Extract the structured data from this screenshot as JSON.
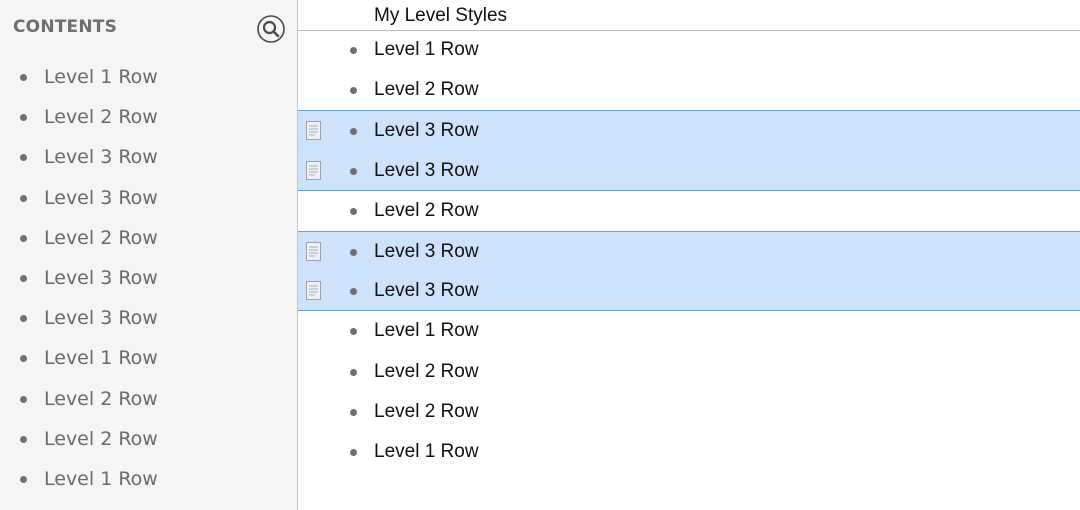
{
  "sidebar": {
    "title": "CONTENTS",
    "search_icon": "magnifier-icon",
    "items": [
      {
        "label": "Level 1 Row"
      },
      {
        "label": "Level 2 Row"
      },
      {
        "label": "Level 3 Row"
      },
      {
        "label": "Level 3 Row"
      },
      {
        "label": "Level 2 Row"
      },
      {
        "label": "Level 3 Row"
      },
      {
        "label": "Level 3 Row"
      },
      {
        "label": "Level 1 Row"
      },
      {
        "label": "Level 2 Row"
      },
      {
        "label": "Level 2 Row"
      },
      {
        "label": "Level 1 Row"
      }
    ]
  },
  "editor": {
    "title": "My Level Styles",
    "rows": [
      {
        "label": "Level 1 Row",
        "selected": false,
        "has_note": false
      },
      {
        "label": "Level 2 Row",
        "selected": false,
        "has_note": false
      },
      {
        "label": "Level 3 Row",
        "selected": true,
        "has_note": true
      },
      {
        "label": "Level 3 Row",
        "selected": true,
        "has_note": true
      },
      {
        "label": "Level 2 Row",
        "selected": false,
        "has_note": false
      },
      {
        "label": "Level 3 Row",
        "selected": true,
        "has_note": true
      },
      {
        "label": "Level 3 Row",
        "selected": true,
        "has_note": true
      },
      {
        "label": "Level 1 Row",
        "selected": false,
        "has_note": false
      },
      {
        "label": "Level 2 Row",
        "selected": false,
        "has_note": false
      },
      {
        "label": "Level 2 Row",
        "selected": false,
        "has_note": false
      },
      {
        "label": "Level 1 Row",
        "selected": false,
        "has_note": false
      }
    ]
  },
  "colors": {
    "selection_fill": "#cfe2fb",
    "selection_border": "#6d9fe0",
    "sidebar_background": "#f5f5f5",
    "bullet": "#707070"
  }
}
